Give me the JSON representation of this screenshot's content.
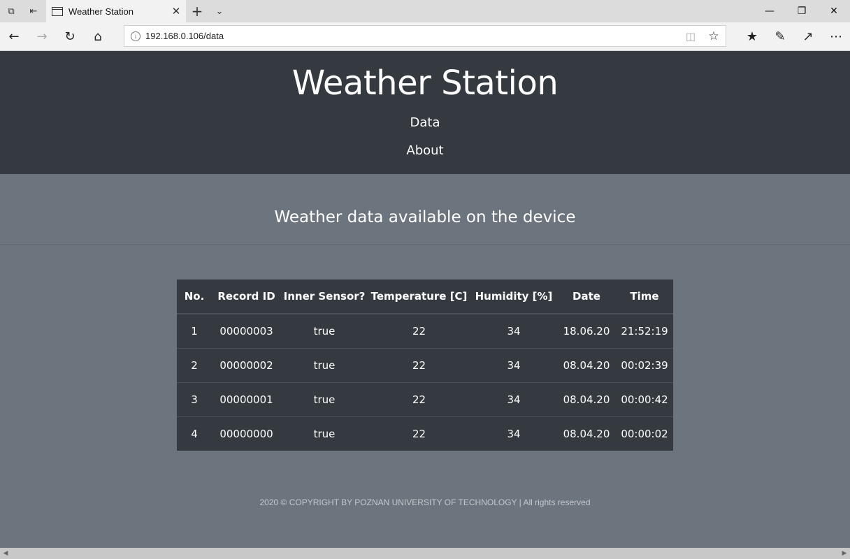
{
  "browser": {
    "tab_title": "Weather Station",
    "url": "192.168.0.106/data"
  },
  "header": {
    "title": "Weather Station",
    "nav": [
      {
        "label": "Data"
      },
      {
        "label": "About"
      }
    ]
  },
  "main": {
    "subtitle": "Weather data available on the device",
    "table": {
      "columns": [
        "No.",
        "Record ID",
        "Inner Sensor?",
        "Temperature [C]",
        "Humidity [%]",
        "Date",
        "Time"
      ],
      "rows": [
        [
          "1",
          "00000003",
          "true",
          "22",
          "34",
          "18.06.20",
          "21:52:19"
        ],
        [
          "2",
          "00000002",
          "true",
          "22",
          "34",
          "08.04.20",
          "00:02:39"
        ],
        [
          "3",
          "00000001",
          "true",
          "22",
          "34",
          "08.04.20",
          "00:00:42"
        ],
        [
          "4",
          "00000000",
          "true",
          "22",
          "34",
          "08.04.20",
          "00:00:02"
        ]
      ]
    }
  },
  "footer": {
    "text": "2020 © COPYRIGHT BY POZNAN UNIVERSITY OF TECHNOLOGY | All rights reserved"
  },
  "colors": {
    "header_bg": "#343a40",
    "page_bg": "#6c757d",
    "text": "#ffffff"
  }
}
